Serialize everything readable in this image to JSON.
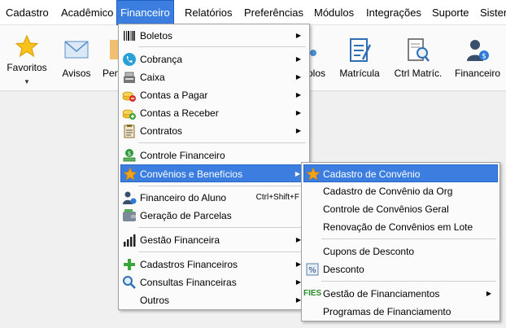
{
  "menubar": {
    "items": [
      "Cadastro",
      "Acadêmico",
      "Financeiro",
      "Relatórios",
      "Preferências",
      "Módulos",
      "Integrações",
      "Suporte",
      "Sister"
    ]
  },
  "toolbar": {
    "items": [
      "Favoritos",
      "Avisos",
      "Pen",
      "olos",
      "Matrícula",
      "Ctrl Matríc.",
      "Financeiro"
    ]
  },
  "financeiro_menu": {
    "items": [
      {
        "label": "Boletos",
        "icon": "barcode-icon"
      },
      {
        "label": "Cobrança",
        "icon": "phone-icon"
      },
      {
        "label": "Caixa",
        "icon": "cash-register-icon"
      },
      {
        "label": "Contas a Pagar",
        "icon": "coins-minus-icon"
      },
      {
        "label": "Contas a Receber",
        "icon": "coins-plus-icon"
      },
      {
        "label": "Contratos",
        "icon": "clipboard-icon"
      },
      {
        "label": "Controle Financeiro",
        "icon": "money-stack-icon"
      },
      {
        "label": "Convênios e Benefícios",
        "icon": "star-icon"
      },
      {
        "label": "Financeiro do Aluno",
        "icon": "user-money-icon",
        "shortcut": "Ctrl+Shift+F"
      },
      {
        "label": "Geração de Parcelas",
        "icon": "wallet-icon"
      },
      {
        "label": "Gestão Financeira",
        "icon": "bar-chart-icon"
      },
      {
        "label": "Cadastros Financeiros",
        "icon": "plus-icon"
      },
      {
        "label": "Consultas Financeiras",
        "icon": "magnifier-icon"
      },
      {
        "label": "Outros",
        "icon": ""
      }
    ]
  },
  "convenios_menu": {
    "items": [
      {
        "label": "Cadastro de Convênio",
        "icon": "star-icon"
      },
      {
        "label": "Cadastro de Convênio da Org",
        "icon": ""
      },
      {
        "label": "Controle de Convênios Geral",
        "icon": ""
      },
      {
        "label": "Renovação de Convênios em Lote",
        "icon": ""
      },
      {
        "label": "Cupons de Desconto",
        "icon": ""
      },
      {
        "label": "Desconto",
        "icon": "percent-icon"
      },
      {
        "label": "Gestão de Financiamentos",
        "icon": "fies-icon",
        "badge": "FIES"
      },
      {
        "label": "Programas de Financiamento",
        "icon": ""
      }
    ]
  },
  "colors": {
    "highlight": "#3b7ee0",
    "highlight_border": "#2a68c8"
  }
}
